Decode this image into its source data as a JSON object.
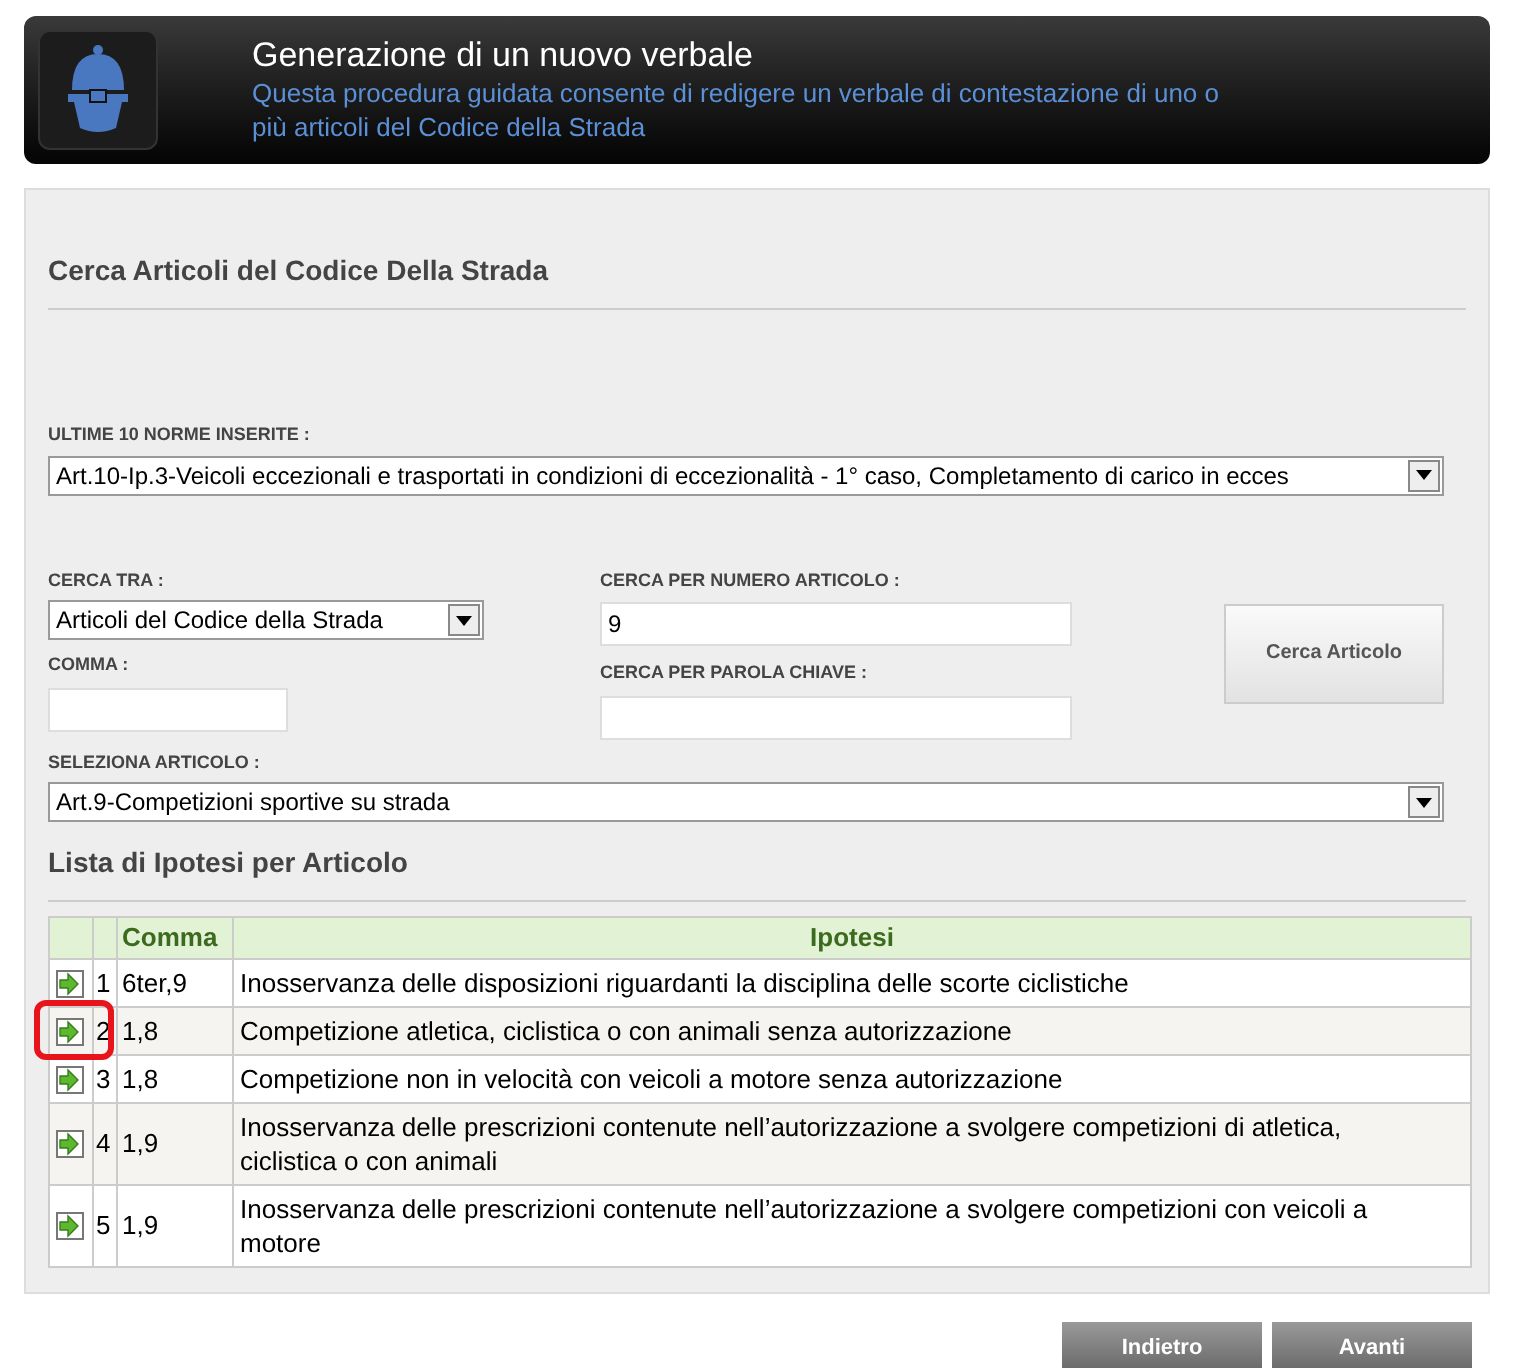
{
  "header": {
    "title": "Generazione di un nuovo verbale",
    "subtitle": "Questa procedura guidata consente di redigere un verbale di contestazione di uno o più articoli del Codice della Strada"
  },
  "search_section": {
    "title": "Cerca Articoli del Codice Della Strada",
    "recent": {
      "label": "ULTIME 10 NORME INSERITE :",
      "value": "Art.10-Ip.3-Veicoli eccezionali e trasportati in condizioni di eccezionalità - 1° caso, Completamento di carico in ecces"
    },
    "search_in": {
      "label": "CERCA TRA :",
      "value": "Articoli del Codice della Strada"
    },
    "article_number": {
      "label": "CERCA PER NUMERO ARTICOLO :",
      "value": "9"
    },
    "comma": {
      "label": "COMMA :"
    },
    "keyword": {
      "label": "CERCA PER PAROLA CHIAVE :"
    },
    "search_button": "Cerca Articolo",
    "select_article": {
      "label": "SELEZIONA ARTICOLO :",
      "value": "Art.9-Competizioni sportive su strada"
    }
  },
  "hypotheses": {
    "title": "Lista di Ipotesi per Articolo",
    "columns": [
      "Comma",
      "Ipotesi"
    ],
    "rows": [
      {
        "number": "1",
        "comma": "6ter,9",
        "text": "Inosservanza delle disposizioni riguardanti la disciplina delle scorte ciclistiche",
        "highlighted": false
      },
      {
        "number": "2",
        "comma": "1,8",
        "text": "Competizione atletica, ciclistica o con animali senza autorizzazione",
        "highlighted": true
      },
      {
        "number": "3",
        "comma": "1,8",
        "text": "Competizione non in velocità con veicoli a motore senza autorizzazione",
        "highlighted": false
      },
      {
        "number": "4",
        "comma": "1,9",
        "text": "Inosservanza delle prescrizioni contenute nell’autorizzazione a svolgere competizioni di atletica, ciclistica o con animali",
        "highlighted": false
      },
      {
        "number": "5",
        "comma": "1,9",
        "text": "Inosservanza delle prescrizioni contenute nell’autorizzazione a svolgere competizioni con veicoli a motore",
        "highlighted": false
      }
    ]
  },
  "buttons": [
    "Indietro",
    "Avanti"
  ]
}
